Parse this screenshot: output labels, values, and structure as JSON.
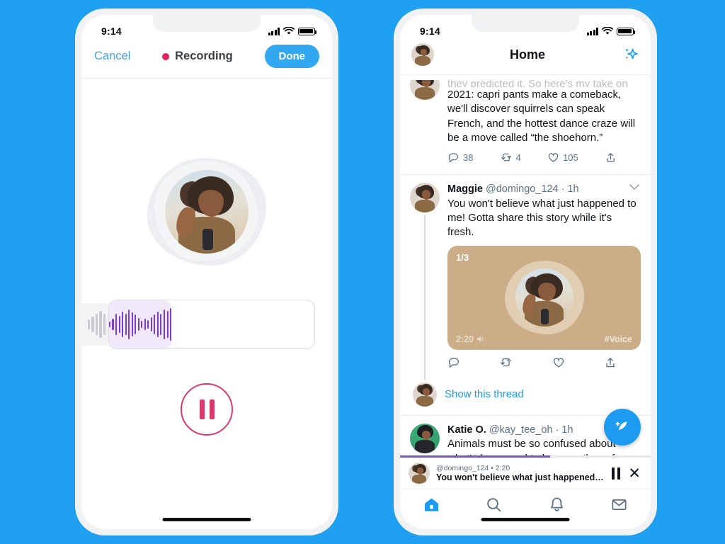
{
  "background_color": "#1fa0f0",
  "accent_blue": "#1d9bf0",
  "recorder_phone": {
    "status_bar": {
      "time": "9:14",
      "signal_icon": "cellular-signal-icon",
      "wifi_icon": "wifi-icon",
      "battery_icon": "battery-icon"
    },
    "topbar": {
      "cancel_label": "Cancel",
      "recording_label": "Recording",
      "recording_dot_color": "#e0245e",
      "done_label": "Done"
    },
    "avatar_alt": "smiling-woman-with-curly-hair-holding-microphone",
    "waveform": {
      "ghost_bars": [
        14,
        22,
        30,
        38,
        30
      ],
      "bars": [
        8,
        16,
        30,
        24,
        36,
        30,
        42,
        34,
        28,
        18,
        10,
        16,
        12,
        20,
        28,
        36,
        30,
        42,
        38,
        46
      ],
      "bar_color": "#7b3ec9",
      "chip_background": "#efe9fa"
    },
    "record_button": {
      "icon": "pause-icon",
      "color": "#d83a6c"
    }
  },
  "twitter_phone": {
    "status_bar": {
      "time": "9:14",
      "signal_icon": "cellular-signal-icon",
      "wifi_icon": "wifi-icon",
      "battery_icon": "battery-icon"
    },
    "header": {
      "profile_avatar": "user-avatar",
      "title": "Home",
      "sparkle_icon": "sparkles-icon"
    },
    "tweets": [
      {
        "clipped": true,
        "text_clipped_line": "they predicted it. So here's my take on",
        "text": "2021: capri pants make a comeback, we'll discover squirrels can speak French, and the hottest dance craze will be a move called “the shoehorn.”",
        "actions": {
          "reply_icon": "reply-icon",
          "reply_count": "38",
          "retweet_icon": "retweet-icon",
          "retweet_count": "4",
          "like_icon": "like-heart-icon",
          "like_count": "105",
          "share_icon": "share-icon"
        }
      },
      {
        "name": "Maggie",
        "handle": "@domingo_124",
        "time": "1h",
        "chevron_icon": "chevron-down-icon",
        "text": "You won't believe what just happened to me! Gotta share this story while it's fresh.",
        "voice_card": {
          "index_label": "1/3",
          "duration": "2:20",
          "speaker_icon": "speaker-icon",
          "hashtag": "#Voice",
          "background_color": "#cbae88",
          "avatar_alt": "smiling-woman-with-curly-hair-holding-microphone"
        },
        "actions": {
          "reply_icon": "reply-icon",
          "retweet_icon": "retweet-icon",
          "like_icon": "like-heart-icon",
          "share_icon": "share-icon"
        },
        "show_thread_label": "Show this thread"
      },
      {
        "name": "Katie O.",
        "handle": "@kay_tee_oh",
        "time": "1h",
        "chevron_icon": "chevron-down-icon",
        "text": "Animals must be so confused about what's happened to humans these few months. Do you think bees are organizing fundraisers to “Save the"
      }
    ],
    "compose_fab": {
      "icon": "compose-feather-icon"
    },
    "progress_bar": {
      "percent": 60,
      "color": "#7b52c6"
    },
    "mini_player": {
      "avatar": "user-avatar",
      "meta": "@domingo_124 • 2:20",
      "title": "You won't believe what just happened…",
      "pause_icon": "pause-icon",
      "close_icon": "close-icon"
    },
    "tabbar": [
      {
        "name": "home",
        "icon": "home-icon",
        "active": true
      },
      {
        "name": "search",
        "icon": "search-icon",
        "active": false
      },
      {
        "name": "notifications",
        "icon": "bell-icon",
        "active": false
      },
      {
        "name": "messages",
        "icon": "envelope-icon",
        "active": false
      }
    ]
  }
}
